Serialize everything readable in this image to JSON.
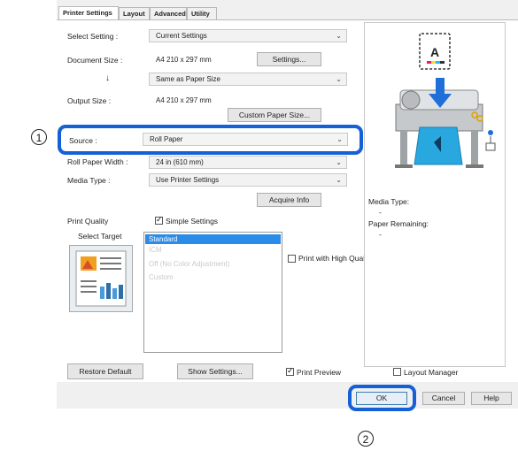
{
  "tabs": [
    "Printer Settings",
    "Layout",
    "Advanced",
    "Utility"
  ],
  "select_setting": {
    "label": "Select Setting :",
    "value": "Current Settings"
  },
  "document_size": {
    "label": "Document Size :",
    "value": "A4 210 x 297 mm",
    "settings_button": "Settings..."
  },
  "arrow": "↓",
  "same_as": {
    "value": "Same as Paper Size"
  },
  "output_size": {
    "label": "Output Size :",
    "value": "A4 210 x 297 mm"
  },
  "custom_paper_button": "Custom Paper Size...",
  "source": {
    "label": "Source :",
    "value": "Roll Paper"
  },
  "roll_width": {
    "label": "Roll Paper Width :",
    "value": "24 in (610 mm)"
  },
  "media_type": {
    "label": "Media Type :",
    "value": "Use Printer Settings"
  },
  "acquire_button": "Acquire Info",
  "print_quality": {
    "label": "Print Quality",
    "simple_settings": "Simple Settings",
    "select_target": "Select Target"
  },
  "targets": [
    "Standard",
    "ICM",
    "Off (No Color Adjustment)",
    "Custom"
  ],
  "high_quality": "Print with High Quality",
  "preview_panel": {
    "media_type_label": "Media Type:",
    "media_type_value": "-",
    "paper_remaining_label": "Paper Remaining:",
    "paper_remaining_value": "-"
  },
  "bottom": {
    "restore": "Restore Default",
    "show": "Show Settings...",
    "print_preview": "Print Preview",
    "layout_manager": "Layout Manager"
  },
  "dialog_buttons": {
    "ok": "OK",
    "cancel": "Cancel",
    "help": "Help"
  },
  "callouts": {
    "one": "1",
    "two": "2"
  },
  "colors": {
    "callout_blue": "#1560d6",
    "selection_blue": "#2b8be8"
  }
}
